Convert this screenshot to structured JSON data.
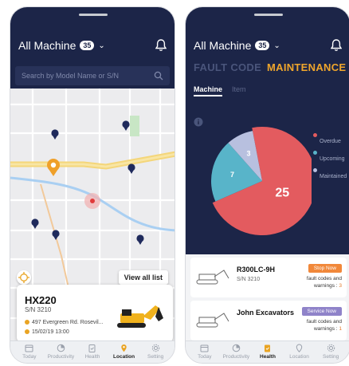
{
  "left_screen": {
    "header": {
      "title": "All Machine",
      "count": "35"
    },
    "search": {
      "placeholder": "Search by Model Name or S/N"
    },
    "map": {
      "view_all_label": "View all list"
    },
    "card": {
      "model": "HX220",
      "serial": "S/N 3210",
      "address": "497 Evergreen Rd. Rosevil...",
      "datetime": "15/02/19 13:00"
    },
    "tabbar": {
      "active": "Location",
      "items": [
        {
          "label": "Today",
          "icon": "calendar-icon"
        },
        {
          "label": "Productivity",
          "icon": "pie-chart-icon"
        },
        {
          "label": "Health",
          "icon": "clipboard-icon"
        },
        {
          "label": "Location",
          "icon": "location-pin-icon"
        },
        {
          "label": "Setting",
          "icon": "gear-icon"
        }
      ]
    }
  },
  "right_screen": {
    "header": {
      "title": "All Machine",
      "count": "35"
    },
    "segments": {
      "fault_code": "FAULT CODE",
      "maintenance": "MAINTENANCE",
      "active": "MAINTENANCE"
    },
    "subtabs": {
      "machine": "Machine",
      "item": "Item",
      "active": "Machine"
    },
    "chart_data": {
      "type": "pie",
      "slices": [
        {
          "label": "Overdue",
          "value": 25,
          "color": "#e35b5f"
        },
        {
          "label": "Upcoming",
          "value": 7,
          "color": "#58b4c9"
        },
        {
          "label": "Maintained",
          "value": 3,
          "color": "#b8c0df"
        }
      ],
      "legend_position": "right"
    },
    "list": [
      {
        "name": "R300LC-9H",
        "serial": "S/N 3210",
        "status": "Stop Now",
        "status_color": "#f1883a",
        "warn_label": "fault codes and warnings : ",
        "warn_count": "3"
      },
      {
        "name": "John Excavators",
        "serial": "",
        "status": "Service Now",
        "status_color": "#8f83c9",
        "warn_label": "fault codes and warnings : ",
        "warn_count": "1"
      }
    ],
    "tabbar": {
      "active": "Health",
      "items": [
        {
          "label": "Today",
          "icon": "calendar-icon"
        },
        {
          "label": "Productivity",
          "icon": "pie-chart-icon"
        },
        {
          "label": "Health",
          "icon": "clipboard-icon"
        },
        {
          "label": "Location",
          "icon": "location-pin-icon"
        },
        {
          "label": "Setting",
          "icon": "gear-icon"
        }
      ]
    }
  }
}
